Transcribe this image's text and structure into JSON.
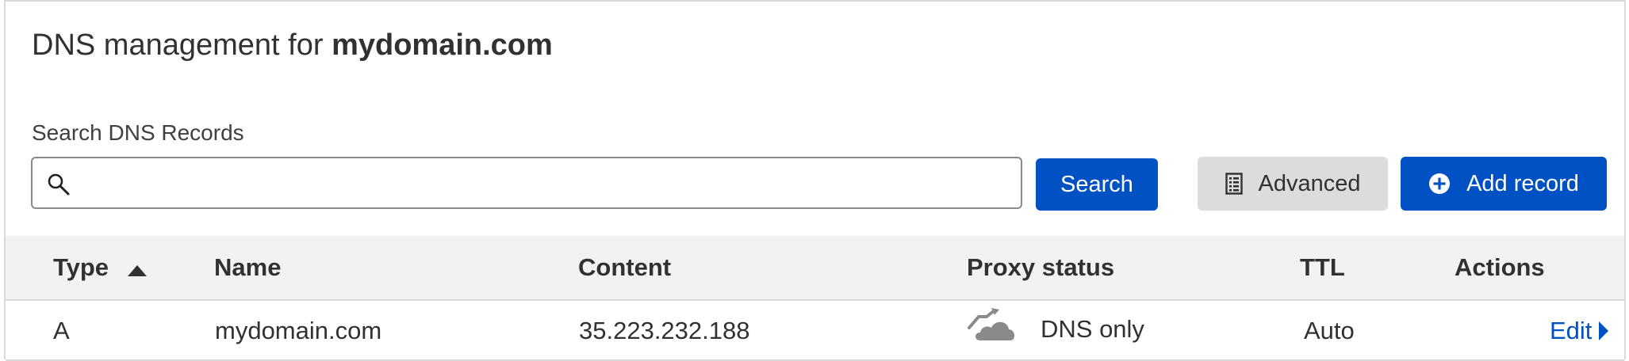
{
  "header": {
    "title_prefix": "DNS management for",
    "domain": "mydomain.com"
  },
  "search": {
    "label": "Search DNS Records",
    "value": "",
    "placeholder": "",
    "search_button": "Search",
    "icon": "search-icon"
  },
  "toolbar": {
    "advanced_label": "Advanced",
    "advanced_icon": "document-list-icon",
    "add_record_label": "Add record",
    "add_record_icon": "plus-circle-icon"
  },
  "table": {
    "columns": [
      "Type",
      "Name",
      "Content",
      "Proxy status",
      "TTL",
      "Actions"
    ],
    "sort_column": "Type",
    "sort_direction": "ascending",
    "rows": [
      {
        "type": "A",
        "name": "mydomain.com",
        "content": "35.223.232.188",
        "proxy_status": "DNS only",
        "proxy_icon": "dns-only-cloud-icon",
        "ttl": "Auto",
        "action": "Edit"
      }
    ]
  },
  "colors": {
    "primary": "#0051c3",
    "secondary_button": "#dcdcdc",
    "header_bg": "#f2f2f2",
    "cloud_gray": "#8a8a8a"
  }
}
